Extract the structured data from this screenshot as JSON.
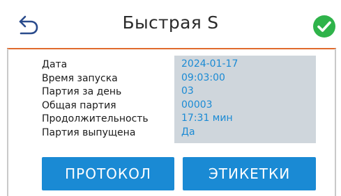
{
  "header": {
    "title": "Быстрая S",
    "back_icon": "back-arrow-icon",
    "status_icon": "check-circle-icon",
    "status_color": "#2fb34a",
    "accent_line_color": "#e06a2c"
  },
  "details": {
    "rows": [
      {
        "label": "Дата",
        "value": "2024-01-17"
      },
      {
        "label": "Время запуска",
        "value": "09:03:00"
      },
      {
        "label": "Партия за день",
        "value": "03"
      },
      {
        "label": "Общая партия",
        "value": "00003"
      },
      {
        "label": "Продолжительность",
        "value": "17:31 мин"
      },
      {
        "label": "Партия выпущена",
        "value": "Да"
      }
    ],
    "value_color": "#1a8ad4",
    "value_bg_color": "#cfd6dc"
  },
  "actions": {
    "protocol_label": "ПРОТОКОЛ",
    "labels_label": "ЭТИКЕТКИ",
    "button_color": "#1a8ad4"
  }
}
